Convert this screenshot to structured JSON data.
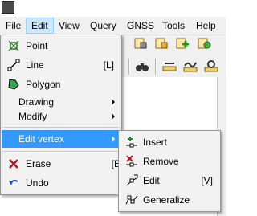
{
  "menubar": {
    "items": [
      "File",
      "Edit",
      "View",
      "Query",
      "GNSS",
      "Tools",
      "Help"
    ],
    "active": "Edit"
  },
  "edit_menu": {
    "items": [
      {
        "label": "Point",
        "icon": "point-icon",
        "shortcut": "",
        "submenu": false
      },
      {
        "label": "Line",
        "icon": "line-icon",
        "shortcut": "[L]",
        "submenu": false
      },
      {
        "label": "Polygon",
        "icon": "polygon-icon",
        "shortcut": "",
        "submenu": false
      },
      {
        "label": "Drawing",
        "icon": "",
        "shortcut": "",
        "submenu": true
      },
      {
        "label": "Modify",
        "icon": "",
        "shortcut": "",
        "submenu": true
      },
      {
        "label": "Edit vertex",
        "icon": "",
        "shortcut": "",
        "submenu": true,
        "highlighted": true
      },
      {
        "label": "Erase",
        "icon": "erase-x-icon",
        "shortcut": "[E",
        "submenu": false
      },
      {
        "label": "Undo",
        "icon": "undo-icon",
        "shortcut": "",
        "submenu": false
      }
    ]
  },
  "edit_vertex_submenu": {
    "items": [
      {
        "label": "Insert",
        "icon": "insert-vertex-icon",
        "shortcut": ""
      },
      {
        "label": "Remove",
        "icon": "remove-vertex-icon",
        "shortcut": ""
      },
      {
        "label": "Edit",
        "icon": "edit-vertex-icon",
        "shortcut": "[V]"
      },
      {
        "label": "Generalize",
        "icon": "generalize-icon",
        "shortcut": ""
      }
    ]
  },
  "colors": {
    "highlight": "#3399ff",
    "menubar_active": "#cce8ff",
    "menu_bg": "#f2f2f2"
  }
}
